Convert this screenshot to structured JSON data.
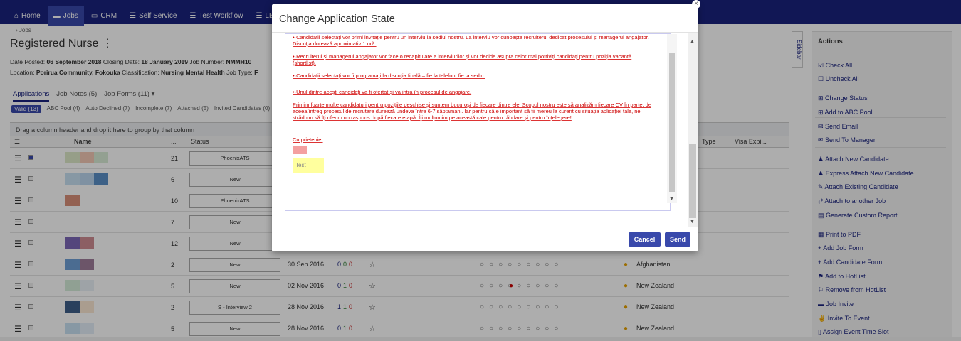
{
  "nav": {
    "tabs": [
      {
        "label": "Home",
        "icon": "home-icon"
      },
      {
        "label": "Jobs",
        "icon": "jobs-icon",
        "active": true
      },
      {
        "label": "CRM",
        "icon": "crm-icon"
      },
      {
        "label": "Self Service",
        "icon": "self-service-icon"
      },
      {
        "label": "Test Workflow",
        "icon": "workflow-icon"
      },
      {
        "label": "LBC",
        "icon": "lbc-icon"
      }
    ]
  },
  "page": {
    "breadcrumb": "› Jobs",
    "title": "Registered Nurse",
    "meta_line1_label1": "Date Posted:",
    "meta_line1_val1": "06 September 2018",
    "meta_line1_label2": "Closing Date:",
    "meta_line1_val2": "18 January 2019",
    "meta_line1_label3": "Job Number:",
    "meta_line1_val3": "NMMH10",
    "meta_line2_label1": "Location:",
    "meta_line2_val1": "Porirua Community, Fokouka",
    "meta_line2_label2": "Classification:",
    "meta_line2_val2": "Nursing Mental Health",
    "meta_line2_label3": "Job Type:",
    "meta_line2_val3": "F"
  },
  "subtabs": [
    {
      "label": "Applications",
      "active": true
    },
    {
      "label": "Job Notes (5)"
    },
    {
      "label": "Job Forms (11) ▾"
    }
  ],
  "pills": [
    {
      "label": "Valid (13)",
      "active": true
    },
    {
      "label": "ABC Pool (4)"
    },
    {
      "label": "Auto Declined (7)"
    },
    {
      "label": "Incomplete (7)"
    },
    {
      "label": "Attached (5)"
    },
    {
      "label": "Invited Candidates (0)"
    }
  ],
  "grid": {
    "group_hint": "Drag a column header and drop it here to group by that column",
    "col_name": "Name",
    "col_status": "Status",
    "col_dots": "...",
    "col_type": "Type",
    "col_visa": "Visa Expi...",
    "rows": [
      {
        "num": "21",
        "status": "PhoenixATS",
        "date": "",
        "c": [
          "",
          "",
          ""
        ],
        "country": "",
        "checked": true
      },
      {
        "num": "6",
        "status": "New",
        "date": "",
        "c": [
          "",
          "",
          ""
        ],
        "country": ""
      },
      {
        "num": "10",
        "status": "PhoenixATS",
        "date": "",
        "c": [
          "",
          "",
          ""
        ],
        "country": ""
      },
      {
        "num": "7",
        "status": "New",
        "date": "",
        "c": [
          "",
          "",
          ""
        ],
        "country": ""
      },
      {
        "num": "12",
        "status": "New",
        "date": "",
        "c": [
          "",
          "",
          ""
        ],
        "country": ""
      },
      {
        "num": "2",
        "status": "New",
        "date": "30 Sep 2016",
        "c": [
          "0",
          "0",
          "0"
        ],
        "country": "Afghanistan"
      },
      {
        "num": "5",
        "status": "New",
        "date": "02 Nov 2016",
        "c": [
          "0",
          "1",
          "0"
        ],
        "country": "New Zealand"
      },
      {
        "num": "2",
        "status": "S - Interview 2",
        "date": "28 Nov 2016",
        "c": [
          "1",
          "1",
          "0"
        ],
        "country": "New Zealand"
      },
      {
        "num": "5",
        "status": "New",
        "date": "28 Nov 2016",
        "c": [
          "0",
          "1",
          "0"
        ],
        "country": "New Zealand"
      }
    ]
  },
  "sidebar_toggle": "Sidebar",
  "actions": {
    "title": "Actions",
    "items": [
      {
        "label": "Check All",
        "icon": "check-square-icon"
      },
      {
        "label": "Uncheck All",
        "icon": "square-icon"
      },
      {
        "label": "Change Status",
        "icon": "status-icon"
      },
      {
        "label": "Add to ABC Pool",
        "icon": "pool-icon"
      },
      {
        "label": "Send Email",
        "icon": "email-icon"
      },
      {
        "label": "Send To Manager",
        "icon": "send-icon"
      },
      {
        "label": "Attach New Candidate",
        "icon": "user-icon"
      },
      {
        "label": "Express Attach New Candidate",
        "icon": "users-icon"
      },
      {
        "label": "Attach Existing Candidate",
        "icon": "paperclip-icon"
      },
      {
        "label": "Attach to another Job",
        "icon": "exchange-icon"
      },
      {
        "label": "Generate Custom Report",
        "icon": "report-icon"
      },
      {
        "label": "Print to PDF",
        "icon": "print-icon"
      },
      {
        "label": "Add Job Form",
        "icon": "plus-icon"
      },
      {
        "label": "Add Candidate Form",
        "icon": "plus-icon"
      },
      {
        "label": "Add to HotList",
        "icon": "flag-icon"
      },
      {
        "label": "Remove from HotList",
        "icon": "flag-outline-icon"
      },
      {
        "label": "Job Invite",
        "icon": "invite-icon"
      },
      {
        "label": "Invite To Event",
        "icon": "thumbs-up-icon"
      },
      {
        "label": "Assign Event Time Slot",
        "icon": "mobile-icon"
      }
    ]
  },
  "modal": {
    "title": "Change Application State",
    "close": "×",
    "p1": "•·Candidații selectați vor primi invitație pentru un interviu la sediul nostru. La interviu vor cunoaște recruiterul dedicat procesului și managerul angajator. Discuția durează aproximativ 1 oră.",
    "p2": "•·Recruiterul și managerul angajator vor face o recapitulare a interviurilor și vor decide asupra celor mai potriviți candidați pentru poziția vacantă (shortlist).",
    "p3": "•·Candidații selectați vor fi programați la discuția finală – fie la telefon, fie la sediu.",
    "p4": "•·Unul dintre acești candidați va fi ofertat și va intra în procesul de angajare.",
    "p5": "Primim foarte multe candidaturi pentru pozițiile deschise și suntem bucuroși de fiecare dintre ele. Scopul nostru este să analizăm fiecare CV în parte, de aceea întreg procesul de recrutare durează undeva între 6-7 săptamani. Iar pentru că e important să fii mereu la curent cu situația aplicației tale, ne străduim să îți oferim un raspuns după fiecare etapă. Îți mulțumim pe această cale pentru răbdare și pentru înțelegere!",
    "p6": "Cu prietenie,",
    "test": "Test",
    "cancel": "Cancel",
    "send": "Send"
  },
  "colors": {
    "nav": "#1a237e",
    "accent": "#3949ab"
  }
}
